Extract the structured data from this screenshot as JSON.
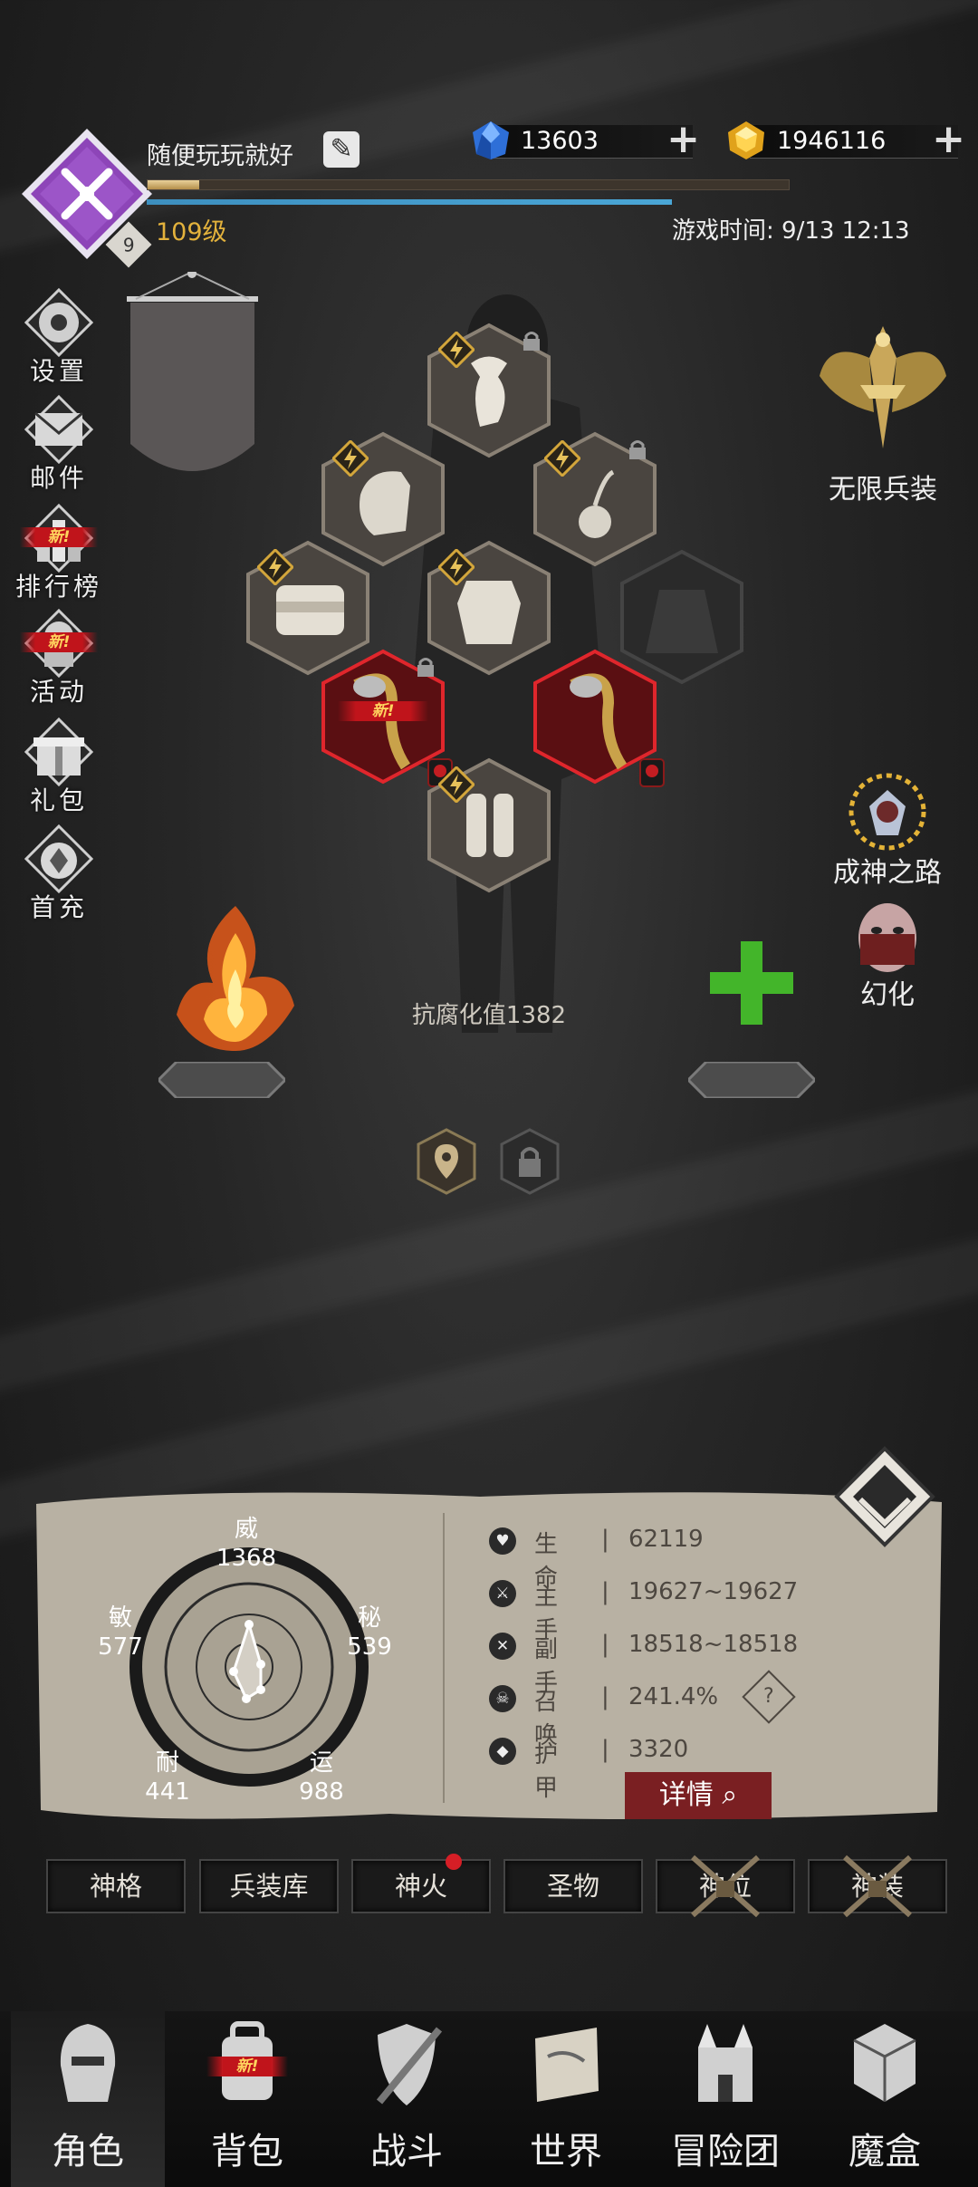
{
  "player": {
    "name": "随便玩玩就好",
    "level": "109级",
    "avatar_level": "9",
    "xp_fraction": 0.08
  },
  "currency": {
    "gems": "13603",
    "gold": "1946116"
  },
  "game_time": "游戏时间: 9/13 12:13",
  "left_menu": [
    {
      "label": "设置",
      "icon": "gear-icon",
      "new": false
    },
    {
      "label": "邮件",
      "icon": "mail-icon",
      "new": false
    },
    {
      "label": "排行榜",
      "icon": "ranking-icon",
      "new": true
    },
    {
      "label": "活动",
      "icon": "event-icon",
      "new": true
    },
    {
      "label": "礼包",
      "icon": "gift-icon",
      "new": false
    },
    {
      "label": "首充",
      "icon": "first-recharge-icon",
      "new": false
    }
  ],
  "new_label": "新!",
  "right_menu": {
    "infinite_gear": "无限兵装",
    "path_to_god": "成神之路",
    "illusion": "幻化"
  },
  "corrosion_text": "抗腐化值1382",
  "attributes": {
    "wei": {
      "label": "威",
      "value": "1368"
    },
    "mi": {
      "label": "秘",
      "value": "539"
    },
    "yun": {
      "label": "运",
      "value": "988"
    },
    "nai": {
      "label": "耐",
      "value": "441"
    },
    "min": {
      "label": "敏",
      "value": "577"
    }
  },
  "stats": [
    {
      "name": "生命",
      "value": "62119",
      "icon": "heart-icon"
    },
    {
      "name": "主手",
      "value": "19627~19627",
      "icon": "main-hand-icon"
    },
    {
      "name": "副手",
      "value": "18518~18518",
      "icon": "off-hand-icon"
    },
    {
      "name": "召唤",
      "value": "241.4%",
      "icon": "summon-icon"
    },
    {
      "name": "护甲",
      "value": "3320",
      "icon": "armor-icon"
    }
  ],
  "detail_button": "详情",
  "tabs": [
    {
      "label": "神格",
      "locked": false,
      "dot": false
    },
    {
      "label": "兵装库",
      "locked": false,
      "dot": false
    },
    {
      "label": "神火",
      "locked": false,
      "dot": true
    },
    {
      "label": "圣物",
      "locked": false,
      "dot": false
    },
    {
      "label": "神位",
      "locked": true,
      "dot": false
    },
    {
      "label": "神装",
      "locked": true,
      "dot": false
    }
  ],
  "bottom_nav": [
    {
      "label": "角色",
      "icon": "helmet-icon",
      "active": true
    },
    {
      "label": "背包",
      "icon": "backpack-icon",
      "active": false,
      "new": true
    },
    {
      "label": "战斗",
      "icon": "battle-shield-icon",
      "active": false
    },
    {
      "label": "世界",
      "icon": "world-map-icon",
      "active": false
    },
    {
      "label": "冒险团",
      "icon": "castle-icon",
      "active": false
    },
    {
      "label": "魔盒",
      "icon": "magic-cube-icon",
      "active": false
    }
  ],
  "colors": {
    "accent_gold": "#e3b23c",
    "danger_red": "#c0141b",
    "panel_paper": "#bdb6a8"
  }
}
